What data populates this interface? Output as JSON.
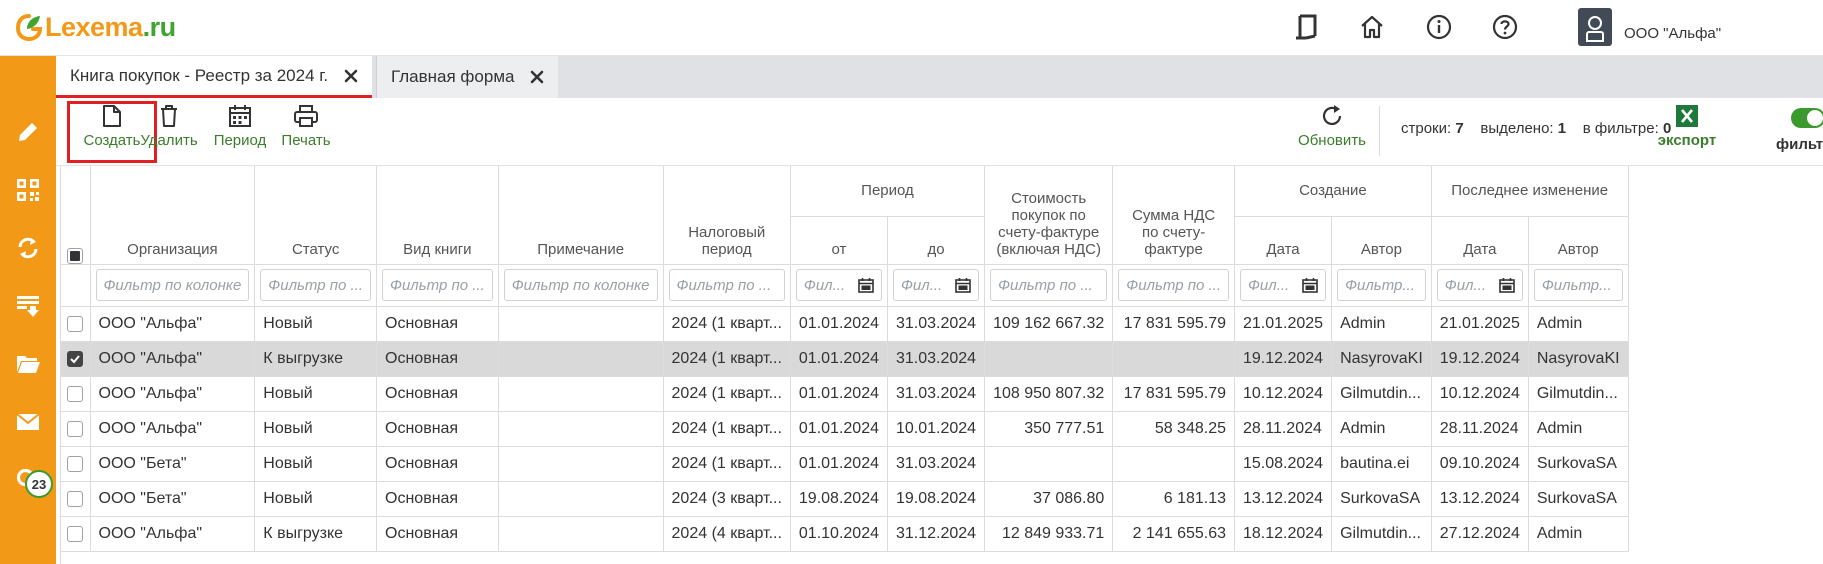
{
  "header": {
    "logo_part1": "Lexema",
    "logo_part2": ".ru",
    "user_name": "ООО \"Альфа\"",
    "icons": [
      "document-icon",
      "home-icon",
      "info-icon",
      "help-icon"
    ]
  },
  "sidebar": {
    "items": [
      "pencil-icon",
      "qr-code-icon",
      "sync-icon",
      "download-list-icon",
      "folder-icon",
      "mail-icon",
      "search-icon"
    ],
    "mail_badge": "23"
  },
  "tabs": [
    {
      "label": "Книга покупок - Реестр за 2024 г.",
      "active": true
    },
    {
      "label": "Главная форма",
      "active": false
    }
  ],
  "toolbar": {
    "create": "Создать",
    "delete": "Удалить",
    "period": "Период",
    "print": "Печать",
    "refresh": "Обновить",
    "rows_label": "строки:",
    "rows_value": "7",
    "selected_label": "выделено:",
    "selected_value": "1",
    "filtered_label": "в фильтре:",
    "filtered_value": "0",
    "export": "экспорт",
    "filter": "фильтр"
  },
  "table": {
    "group_headers": {
      "period": "Период",
      "created": "Создание",
      "modified": "Последнее изменение"
    },
    "columns": {
      "org": "Организация",
      "status": "Статус",
      "kind": "Вид книги",
      "note": "Примечание",
      "tax_period": "Налоговый период",
      "from": "от",
      "to": "до",
      "cost": "Стоимость покупок по счету-фактуре (включая НДС)",
      "vat": "Сумма НДС по счету-фактуре",
      "c_date": "Дата",
      "c_author": "Автор",
      "m_date": "Дата",
      "m_author": "Автор"
    },
    "filters": {
      "org": "Фильтр по колонке",
      "status": "Фильтр по ...",
      "kind": "Фильтр по ...",
      "note": "Фильтр по колонке",
      "tax_period": "Фильтр по ...",
      "from": "Фил...",
      "to": "Фил...",
      "cost": "Фильтр по ...",
      "vat": "Фильтр по ...",
      "c_date": "Фил...",
      "c_author": "Фильтр...",
      "m_date": "Фил...",
      "m_author": "Фильтр..."
    },
    "rows": [
      {
        "org": "ООО \"Альфа\"",
        "status": "Новый",
        "kind": "Основная",
        "note": "",
        "tax_period": "2024 (1 кварт...",
        "from": "01.01.2024",
        "to": "31.03.2024",
        "cost": "109 162 667.32",
        "vat": "17 831 595.79",
        "c_date": "21.01.2025",
        "c_author": "Admin",
        "m_date": "21.01.2025",
        "m_author": "Admin",
        "selected": false
      },
      {
        "org": "ООО \"Альфа\"",
        "status": "К выгрузке",
        "kind": "Основная",
        "note": "",
        "tax_period": "2024 (1 кварт...",
        "from": "01.01.2024",
        "to": "31.03.2024",
        "cost": "",
        "vat": "",
        "c_date": "19.12.2024",
        "c_author": "NasyrovaKI",
        "m_date": "19.12.2024",
        "m_author": "NasyrovaKI",
        "selected": true
      },
      {
        "org": "ООО \"Альфа\"",
        "status": "Новый",
        "kind": "Основная",
        "note": "",
        "tax_period": "2024 (1 кварт...",
        "from": "01.01.2024",
        "to": "31.03.2024",
        "cost": "108 950 807.32",
        "vat": "17 831 595.79",
        "c_date": "10.12.2024",
        "c_author": "Gilmutdin...",
        "m_date": "10.12.2024",
        "m_author": "Gilmutdin...",
        "selected": false
      },
      {
        "org": "ООО \"Альфа\"",
        "status": "Новый",
        "kind": "Основная",
        "note": "",
        "tax_period": "2024 (1 кварт...",
        "from": "01.01.2024",
        "to": "10.01.2024",
        "cost": "350 777.51",
        "vat": "58 348.25",
        "c_date": "28.11.2024",
        "c_author": "Admin",
        "m_date": "28.11.2024",
        "m_author": "Admin",
        "selected": false
      },
      {
        "org": "ООО \"Бета\"",
        "status": "Новый",
        "kind": "Основная",
        "note": "",
        "tax_period": "2024 (1 кварт...",
        "from": "01.01.2024",
        "to": "31.03.2024",
        "cost": "",
        "vat": "",
        "c_date": "15.08.2024",
        "c_author": "bautina.ei",
        "m_date": "09.10.2024",
        "m_author": "SurkovaSA",
        "selected": false
      },
      {
        "org": "ООО \"Бета\"",
        "status": "Новый",
        "kind": "Основная",
        "note": "",
        "tax_period": "2024 (3 кварт...",
        "from": "19.08.2024",
        "to": "19.08.2024",
        "cost": "37 086.80",
        "vat": "6 181.13",
        "c_date": "13.12.2024",
        "c_author": "SurkovaSA",
        "m_date": "13.12.2024",
        "m_author": "SurkovaSA",
        "selected": false
      },
      {
        "org": "ООО \"Альфа\"",
        "status": "К выгрузке",
        "kind": "Основная",
        "note": "",
        "tax_period": "2024 (4 кварт...",
        "from": "01.10.2024",
        "to": "31.12.2024",
        "cost": "12 849 933.71",
        "vat": "2 141 655.63",
        "c_date": "18.12.2024",
        "c_author": "Gilmutdin...",
        "m_date": "27.12.2024",
        "m_author": "Admin",
        "selected": false
      }
    ]
  },
  "colors": {
    "accent_orange": "#f29a18",
    "accent_green": "#3a9a2e",
    "highlight_red": "#e31e24",
    "selected_row": "#d9d9d9"
  }
}
